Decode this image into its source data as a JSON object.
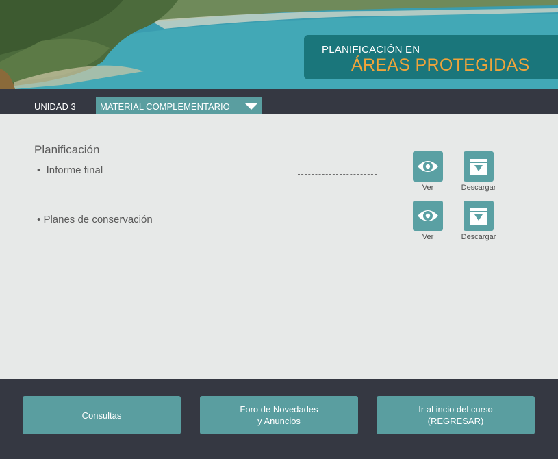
{
  "header": {
    "title_line1": "PLANIFICACIÓN EN",
    "title_line2": "ÁREAS PROTEGIDAS"
  },
  "nav": {
    "unit_label": "UNIDAD 3",
    "material_label": "MATERIAL COMPLEMENTARIO",
    "material_icon": "triangle-down-icon"
  },
  "main": {
    "section_title": "Planificación",
    "items": [
      {
        "bullet": "•",
        "label": "Informe final",
        "view_label": "Ver",
        "download_label": "Descargar"
      },
      {
        "bullet": "•",
        "label": "Planes de conservación",
        "view_label": "Ver",
        "download_label": "Descargar"
      }
    ]
  },
  "footer": {
    "buttons": [
      {
        "label": "Consultas"
      },
      {
        "label": "Foro de Novedades\ny Anuncios"
      },
      {
        "label": "Ir al incio del curso\n(REGRESAR)"
      }
    ]
  },
  "colors": {
    "teal": "#5a9ea0",
    "dark": "#353842",
    "panel": "#e7e9e8",
    "accent_orange": "#f0a43a"
  }
}
